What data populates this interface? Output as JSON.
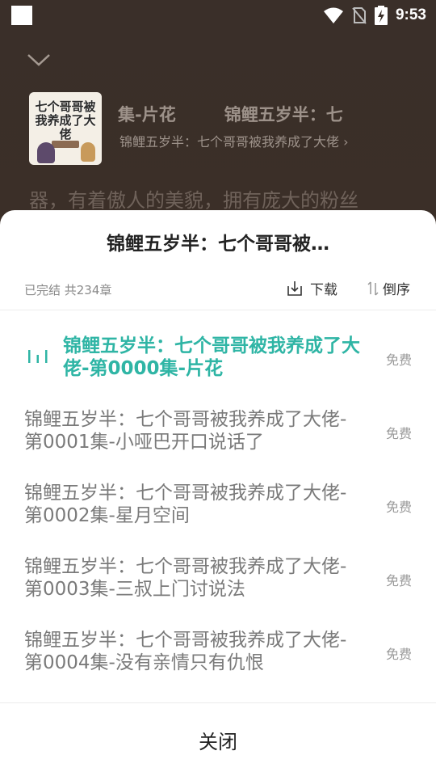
{
  "status_bar": {
    "time": "9:53",
    "icons": [
      "notification-square",
      "wifi-icon",
      "no-sim-icon",
      "battery-charging-icon"
    ]
  },
  "player": {
    "title_part1": "集-片花",
    "title_part2": "锦鲤五岁半：七",
    "subtitle": "锦鲤五岁半：七个哥哥被我养成了大佬",
    "chevron": "›",
    "description": "器，有着傲人的美貌，拥有庞大的粉丝",
    "cover_title": "七个哥哥被我养成了大佬"
  },
  "sheet": {
    "title": "锦鲤五岁半：七个哥哥被…",
    "meta": "已完结 共234章",
    "download_label": "下载",
    "sort_label": "倒序",
    "close_label": "关闭"
  },
  "episodes": [
    {
      "title": "锦鲤五岁半：七个哥哥被我养成了大佬-第0000集-片花",
      "price": "免费",
      "playing": true
    },
    {
      "title": "锦鲤五岁半：七个哥哥被我养成了大佬-第0001集-小哑巴开口说话了",
      "price": "免费",
      "playing": false
    },
    {
      "title": "锦鲤五岁半：七个哥哥被我养成了大佬-第0002集-星月空间",
      "price": "免费",
      "playing": false
    },
    {
      "title": "锦鲤五岁半：七个哥哥被我养成了大佬-第0003集-三叔上门讨说法",
      "price": "免费",
      "playing": false
    },
    {
      "title": "锦鲤五岁半：七个哥哥被我养成了大佬-第0004集-没有亲情只有仇恨",
      "price": "免费",
      "playing": false
    }
  ],
  "colors": {
    "accent": "#2fb5a5",
    "background_dim": "#3a2f29",
    "sheet": "#ffffff"
  }
}
